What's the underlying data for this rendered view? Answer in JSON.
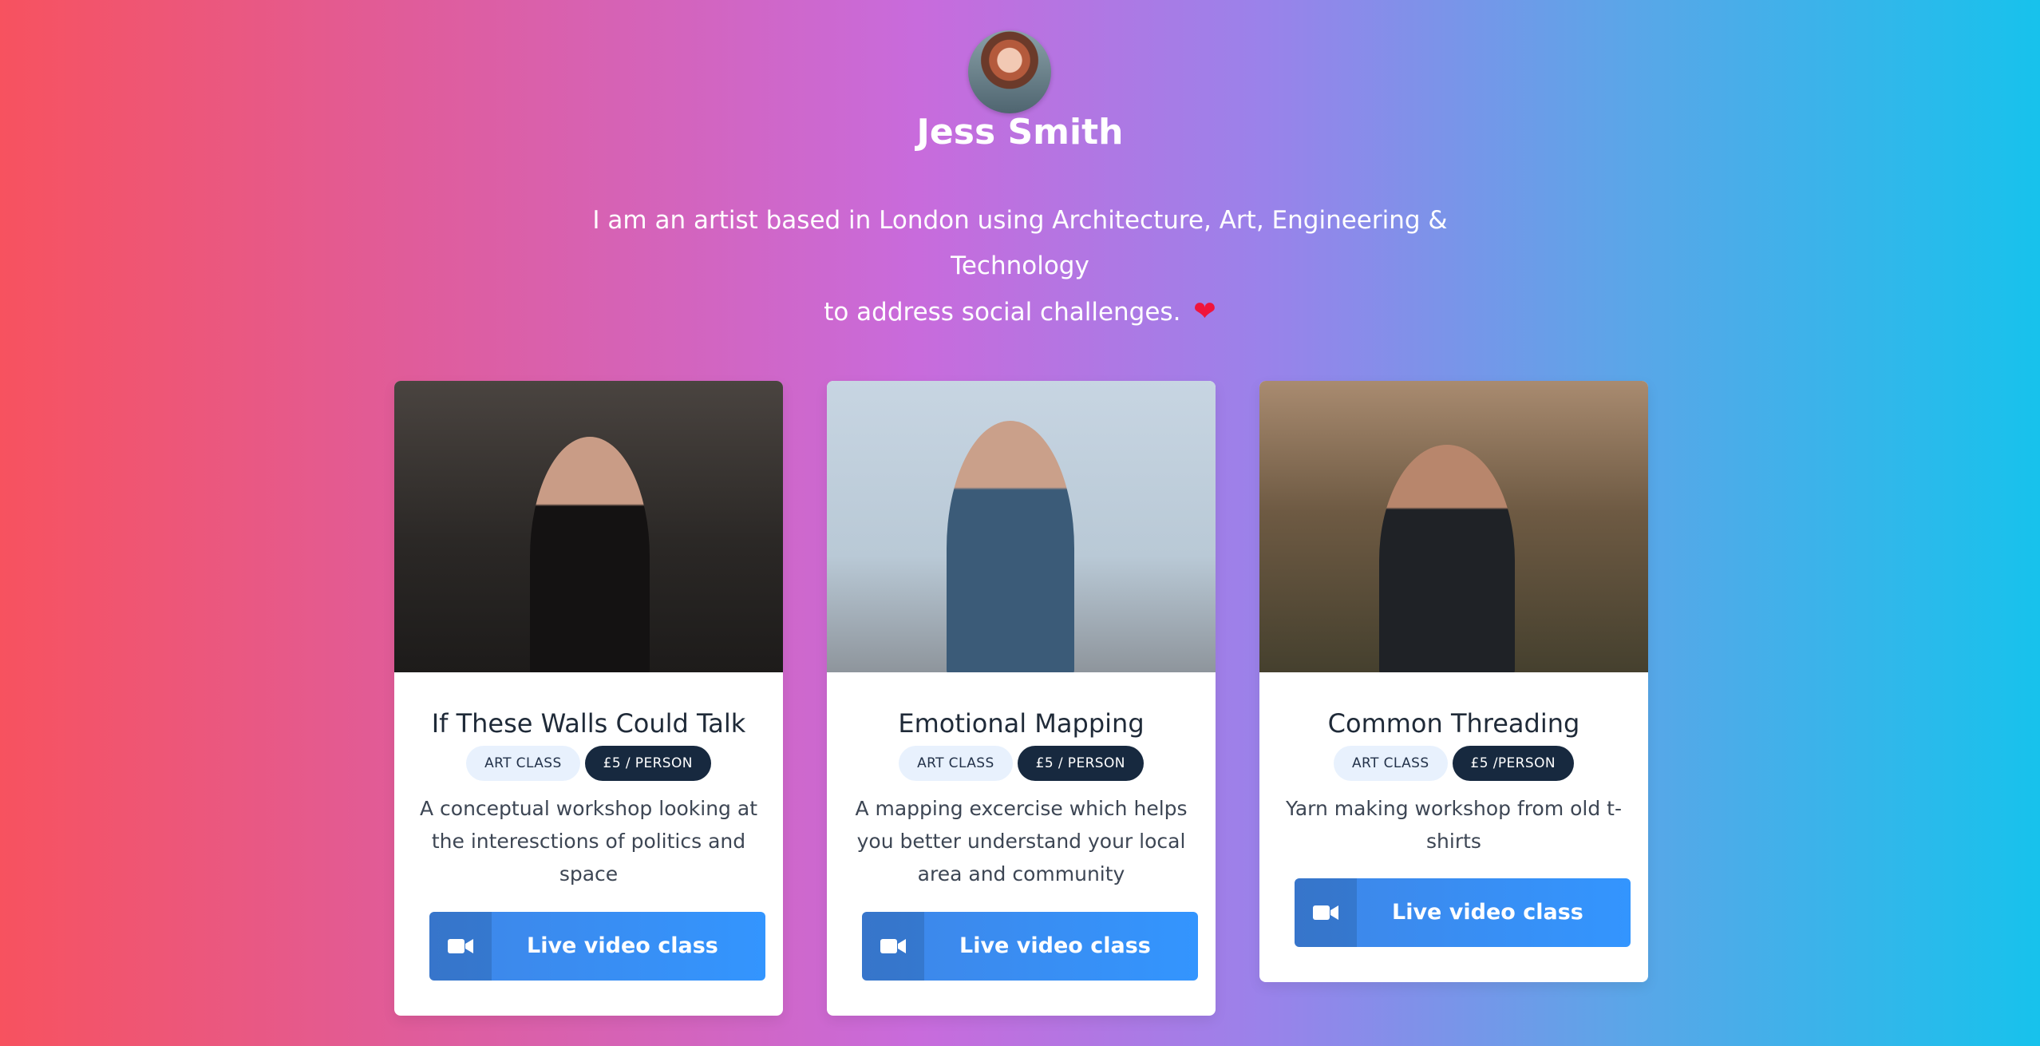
{
  "profile": {
    "name": "Jess Smith",
    "bio_line1": "I am an artist based in London using Architecture, Art, Engineering & Technology",
    "bio_line2": "to address social challenges.",
    "heart": "❤"
  },
  "cards": [
    {
      "title": "If These Walls Could Talk",
      "tag_type": "ART CLASS",
      "tag_price": "£5 / PERSON",
      "description": "A conceptual workshop looking at the interesctions of politics and space",
      "button_label": "Live video class",
      "button_icon": "video-camera-icon"
    },
    {
      "title": "Emotional Mapping",
      "tag_type": "ART CLASS",
      "tag_price": "£5 / PERSON",
      "description": "A mapping excercise which helps you better understand your local area and community",
      "button_label": "Live video class",
      "button_icon": "video-camera-icon"
    },
    {
      "title": "Common Threading",
      "tag_type": "ART CLASS",
      "tag_price": "£5 /PERSON",
      "description": "Yarn making workshop from old t-shirts",
      "button_label": "Live video class",
      "button_icon": "video-camera-icon"
    }
  ],
  "colors": {
    "button": "#3395fe",
    "price_tag": "#17293f",
    "type_tag": "#e8f1fd",
    "heart": "#f0143c"
  }
}
